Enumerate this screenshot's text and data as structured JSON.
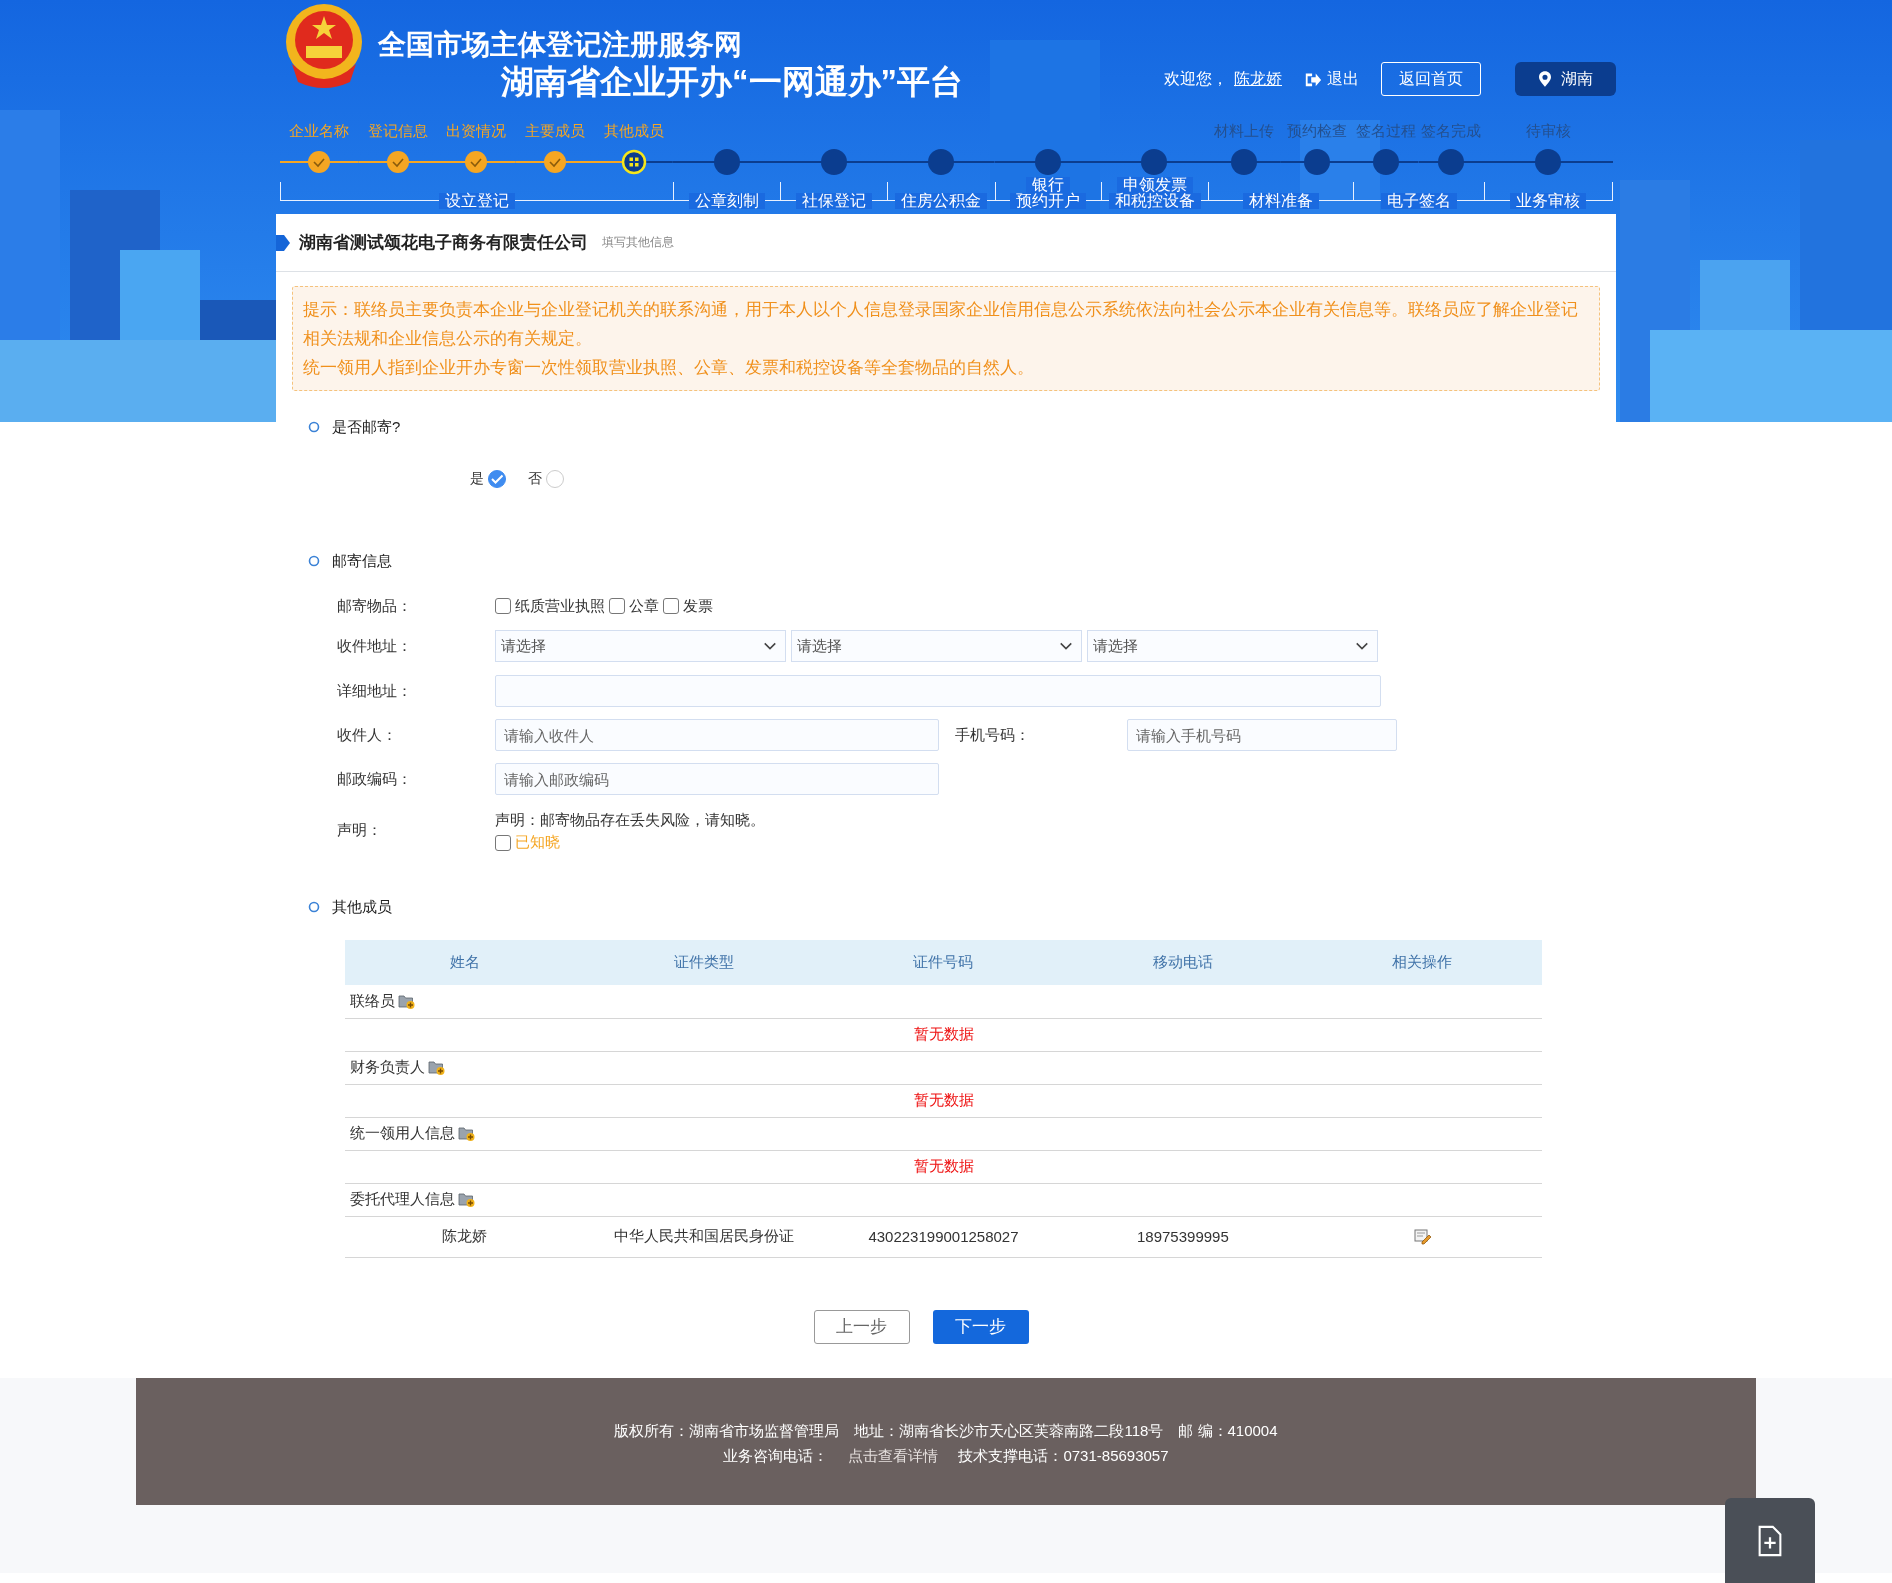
{
  "header": {
    "title": "全国市场主体登记注册服务网",
    "subtitle": "湖南省企业开办“一网通办”平台",
    "welcome": "欢迎您，",
    "user": "陈龙娇",
    "logout": "退出",
    "home_button": "返回首页",
    "region": "湖南"
  },
  "stepper": {
    "groups": [
      {
        "lines": [
          "设立登记"
        ],
        "steps": [
          {
            "label": "企业名称",
            "completed": true,
            "selected": false
          },
          {
            "label": "登记信息",
            "completed": true,
            "selected": false
          },
          {
            "label": "出资情况",
            "completed": true,
            "selected": false
          },
          {
            "label": "主要成员",
            "completed": true,
            "selected": false
          },
          {
            "label": "其他成员",
            "completed": false,
            "selected": true
          }
        ]
      },
      {
        "lines": [
          "公章刻制"
        ],
        "steps": [
          {
            "completed": false,
            "selected": false
          }
        ]
      },
      {
        "lines": [
          "社保登记"
        ],
        "steps": [
          {
            "completed": false,
            "selected": false
          }
        ]
      },
      {
        "lines": [
          "住房公积金"
        ],
        "steps": [
          {
            "completed": false,
            "selected": false
          }
        ]
      },
      {
        "lines": [
          "银行",
          "预约开户"
        ],
        "steps": [
          {
            "completed": false,
            "selected": false
          }
        ]
      },
      {
        "lines": [
          "申领发票",
          "和税控设备"
        ],
        "steps": [
          {
            "completed": false,
            "selected": false
          }
        ]
      },
      {
        "lines": [
          "材料准备"
        ],
        "steps": [
          {
            "label": "材料上传",
            "completed": false,
            "selected": false
          },
          {
            "label": "预约检查",
            "completed": false,
            "selected": false
          }
        ]
      },
      {
        "lines": [
          "电子签名"
        ],
        "steps": [
          {
            "label": "签名过程",
            "completed": false,
            "selected": false
          },
          {
            "label": "签名完成",
            "completed": false,
            "selected": false
          }
        ]
      },
      {
        "lines": [
          "业务审核"
        ],
        "steps": [
          {
            "label": "待审核",
            "completed": false,
            "selected": false
          }
        ]
      }
    ]
  },
  "company": {
    "name": "湖南省测试颂花电子商务有限责任公司",
    "hint": "填写其他信息"
  },
  "notice": [
    "提示：联络员主要负责本企业与企业登记机关的联系沟通，用于本人以个人信息登录国家企业信用信息公示系统依法向社会公示本企业有关信息等。联络员应了解企业登记相关法规和企业信息公示的有关规定。",
    "统一领用人指到企业开办专窗一次性领取营业执照、公章、发票和税控设备等全套物品的自然人。"
  ],
  "mail_choice": {
    "title": "是否邮寄?",
    "options": [
      {
        "label": "是",
        "selected": true
      },
      {
        "label": "否",
        "selected": false
      }
    ]
  },
  "mail_info": {
    "title": "邮寄信息",
    "rows": [
      {
        "kind": "checks",
        "label": "邮寄物品：",
        "options": [
          {
            "label": "纸质营业执照",
            "checked": false
          },
          {
            "label": "公章",
            "checked": false
          },
          {
            "label": "发票",
            "checked": false
          }
        ]
      },
      {
        "kind": "selects",
        "label": "收件地址：",
        "selects": [
          {
            "placeholder": "请选择"
          },
          {
            "placeholder": "请选择"
          },
          {
            "placeholder": "请选择"
          }
        ]
      },
      {
        "kind": "input",
        "label": "详细地址："
      },
      {
        "kind": "pair",
        "label": "收件人：",
        "placeholder": "请输入收件人",
        "extra": {
          "label": "手机号码：",
          "placeholder": "请输入手机号码"
        }
      },
      {
        "kind": "short",
        "label": "邮政编码：",
        "placeholder": "请输入邮政编码"
      },
      {
        "kind": "statement",
        "label": "声明：",
        "text": "声明：邮寄物品存在丢失风险，请知晓。",
        "agree": {
          "label": "已知晓",
          "checked": false
        }
      }
    ]
  },
  "members": {
    "title": "其他成员",
    "columns": [
      "姓名",
      "证件类型",
      "证件号码",
      "移动电话",
      "相关操作"
    ],
    "groups": [
      {
        "label": "联络员",
        "empty_text": "暂无数据"
      },
      {
        "label": "财务负责人",
        "empty_text": "暂无数据"
      },
      {
        "label": "统一领用人信息",
        "empty_text": "暂无数据"
      },
      {
        "label": "委托代理人信息",
        "rows": [
          {
            "cells": [
              "陈龙娇",
              "中华人民共和国居民身份证",
              "430223199001258027",
              "18975399995"
            ],
            "editable": true
          }
        ]
      }
    ]
  },
  "buttons": [
    {
      "label": "上一步",
      "kind": "secondary"
    },
    {
      "label": "下一步",
      "kind": "primary"
    }
  ],
  "footer": {
    "line1": "版权所有：湖南省市场监督管理局　地址：湖南省长沙市天心区芙蓉南路二段118号　邮 编：410004",
    "consult": "业务咨询电话：",
    "consult_link": "点击查看详情",
    "support": "技术支撑电话：0731-85693057"
  }
}
